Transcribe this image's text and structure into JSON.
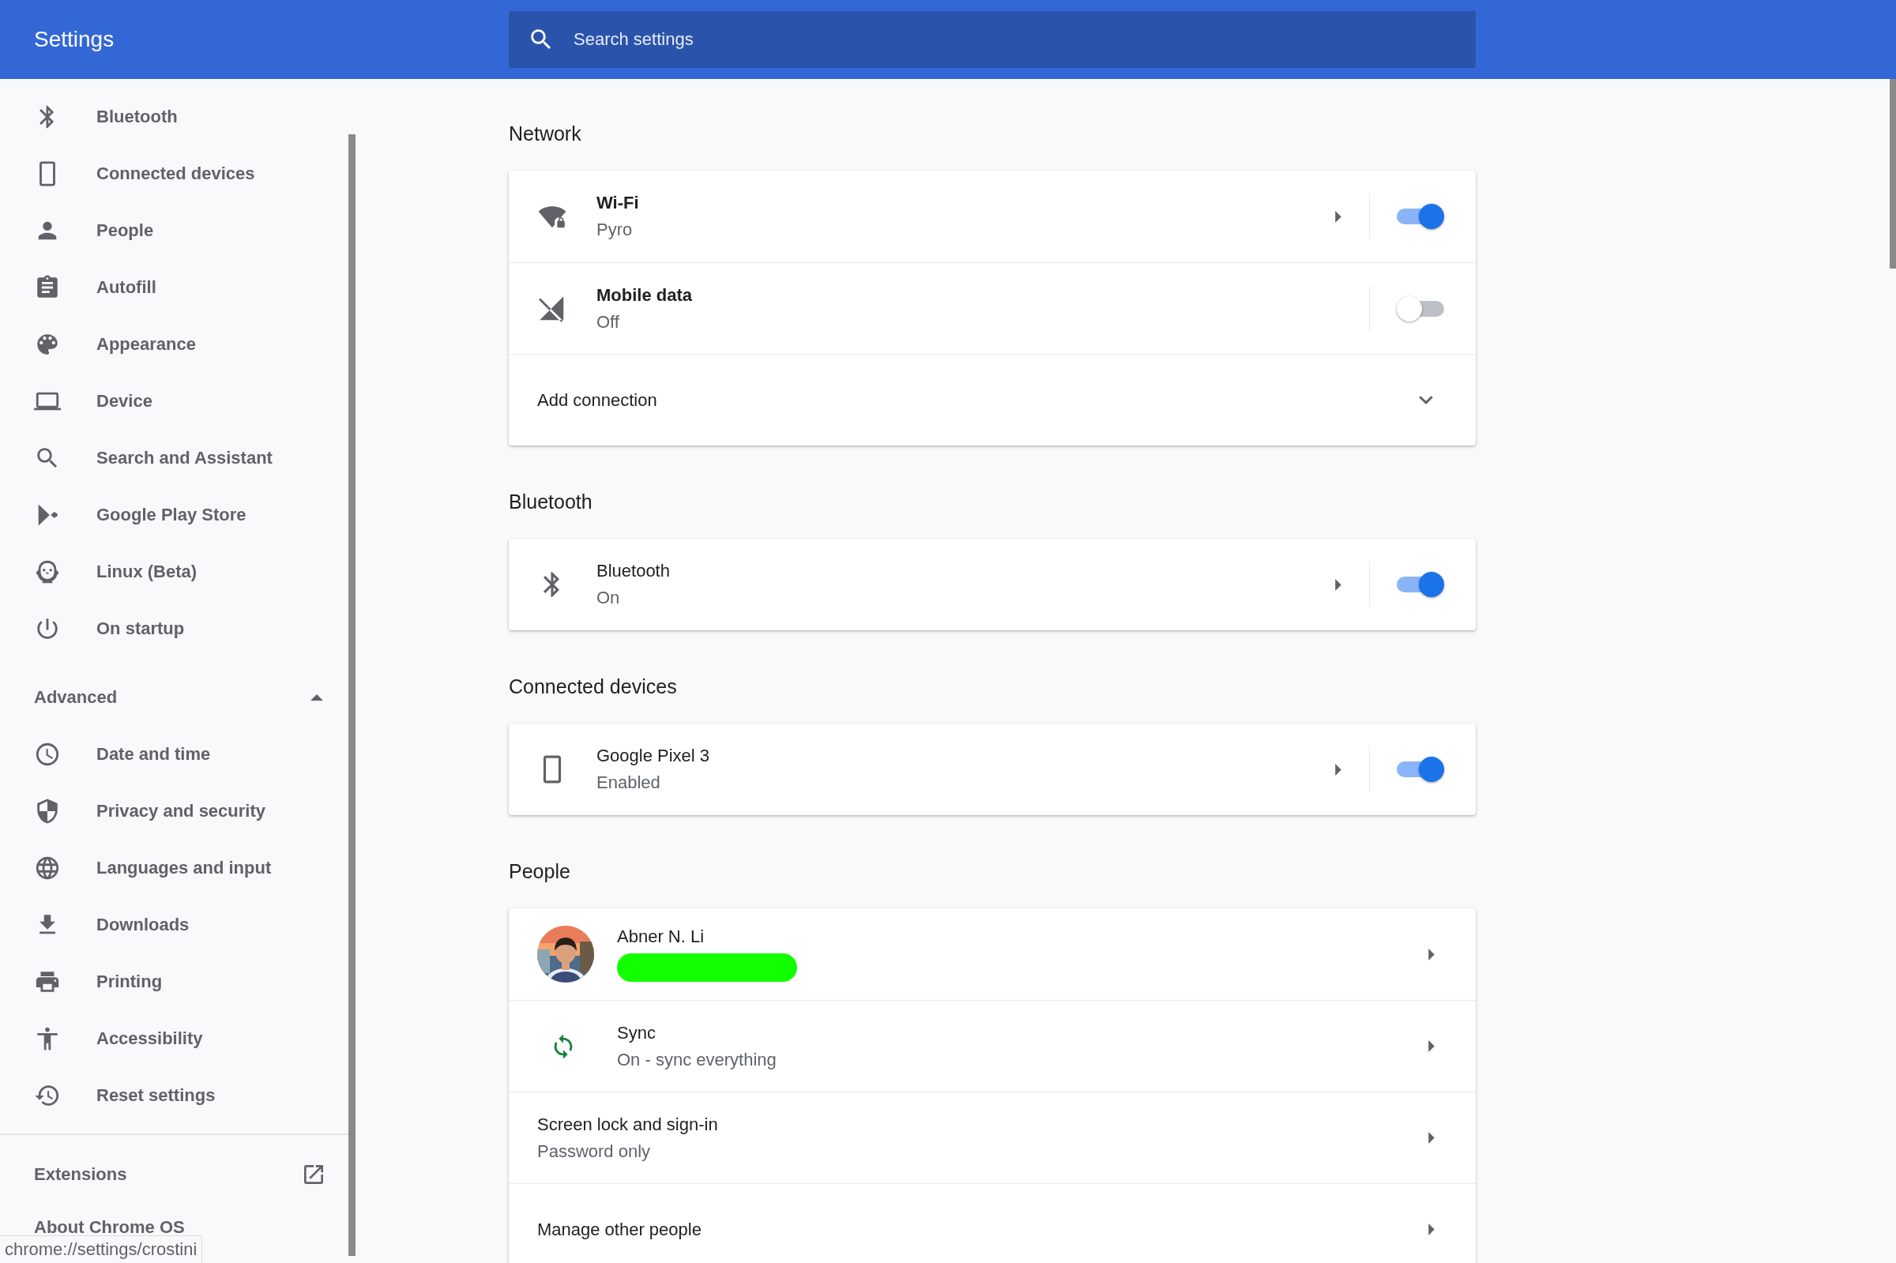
{
  "header": {
    "title": "Settings",
    "search": {
      "placeholder": "Search settings"
    }
  },
  "sidebar": {
    "items": [
      {
        "label": "Bluetooth"
      },
      {
        "label": "Connected devices"
      },
      {
        "label": "People"
      },
      {
        "label": "Autofill"
      },
      {
        "label": "Appearance"
      },
      {
        "label": "Device"
      },
      {
        "label": "Search and Assistant"
      },
      {
        "label": "Google Play Store"
      },
      {
        "label": "Linux (Beta)"
      },
      {
        "label": "On startup"
      }
    ],
    "advanced": {
      "label": "Advanced",
      "expanded": true,
      "items": [
        {
          "label": "Date and time"
        },
        {
          "label": "Privacy and security"
        },
        {
          "label": "Languages and input"
        },
        {
          "label": "Downloads"
        },
        {
          "label": "Printing"
        },
        {
          "label": "Accessibility"
        },
        {
          "label": "Reset settings"
        }
      ]
    },
    "extensions": {
      "label": "Extensions"
    },
    "about": {
      "label": "About Chrome OS"
    }
  },
  "sections": [
    {
      "title": "Network",
      "rows": [
        {
          "kind": "toggle",
          "title": "Wi-Fi",
          "subtitle": "Pyro",
          "bold": true,
          "arrow": true,
          "on": true
        },
        {
          "kind": "toggle",
          "title": "Mobile data",
          "subtitle": "Off",
          "bold": true,
          "arrow": false,
          "on": false
        },
        {
          "kind": "expand",
          "title": "Add connection",
          "expanded": false
        }
      ]
    },
    {
      "title": "Bluetooth",
      "rows": [
        {
          "kind": "toggle",
          "title": "Bluetooth",
          "subtitle": "On",
          "bold": false,
          "arrow": true,
          "on": true
        }
      ]
    },
    {
      "title": "Connected devices",
      "rows": [
        {
          "kind": "toggle",
          "title": "Google Pixel 3",
          "subtitle": "Enabled",
          "bold": false,
          "arrow": true,
          "on": true
        }
      ]
    },
    {
      "title": "People",
      "rows": [
        {
          "kind": "account",
          "title": "Abner N. Li"
        },
        {
          "kind": "link",
          "title": "Sync",
          "subtitle": "On - sync everything"
        },
        {
          "kind": "link",
          "title": "Screen lock and sign-in",
          "subtitle": "Password only"
        },
        {
          "kind": "link",
          "title": "Manage other people"
        }
      ]
    }
  ],
  "status_bar": "chrome://settings/crostini"
}
